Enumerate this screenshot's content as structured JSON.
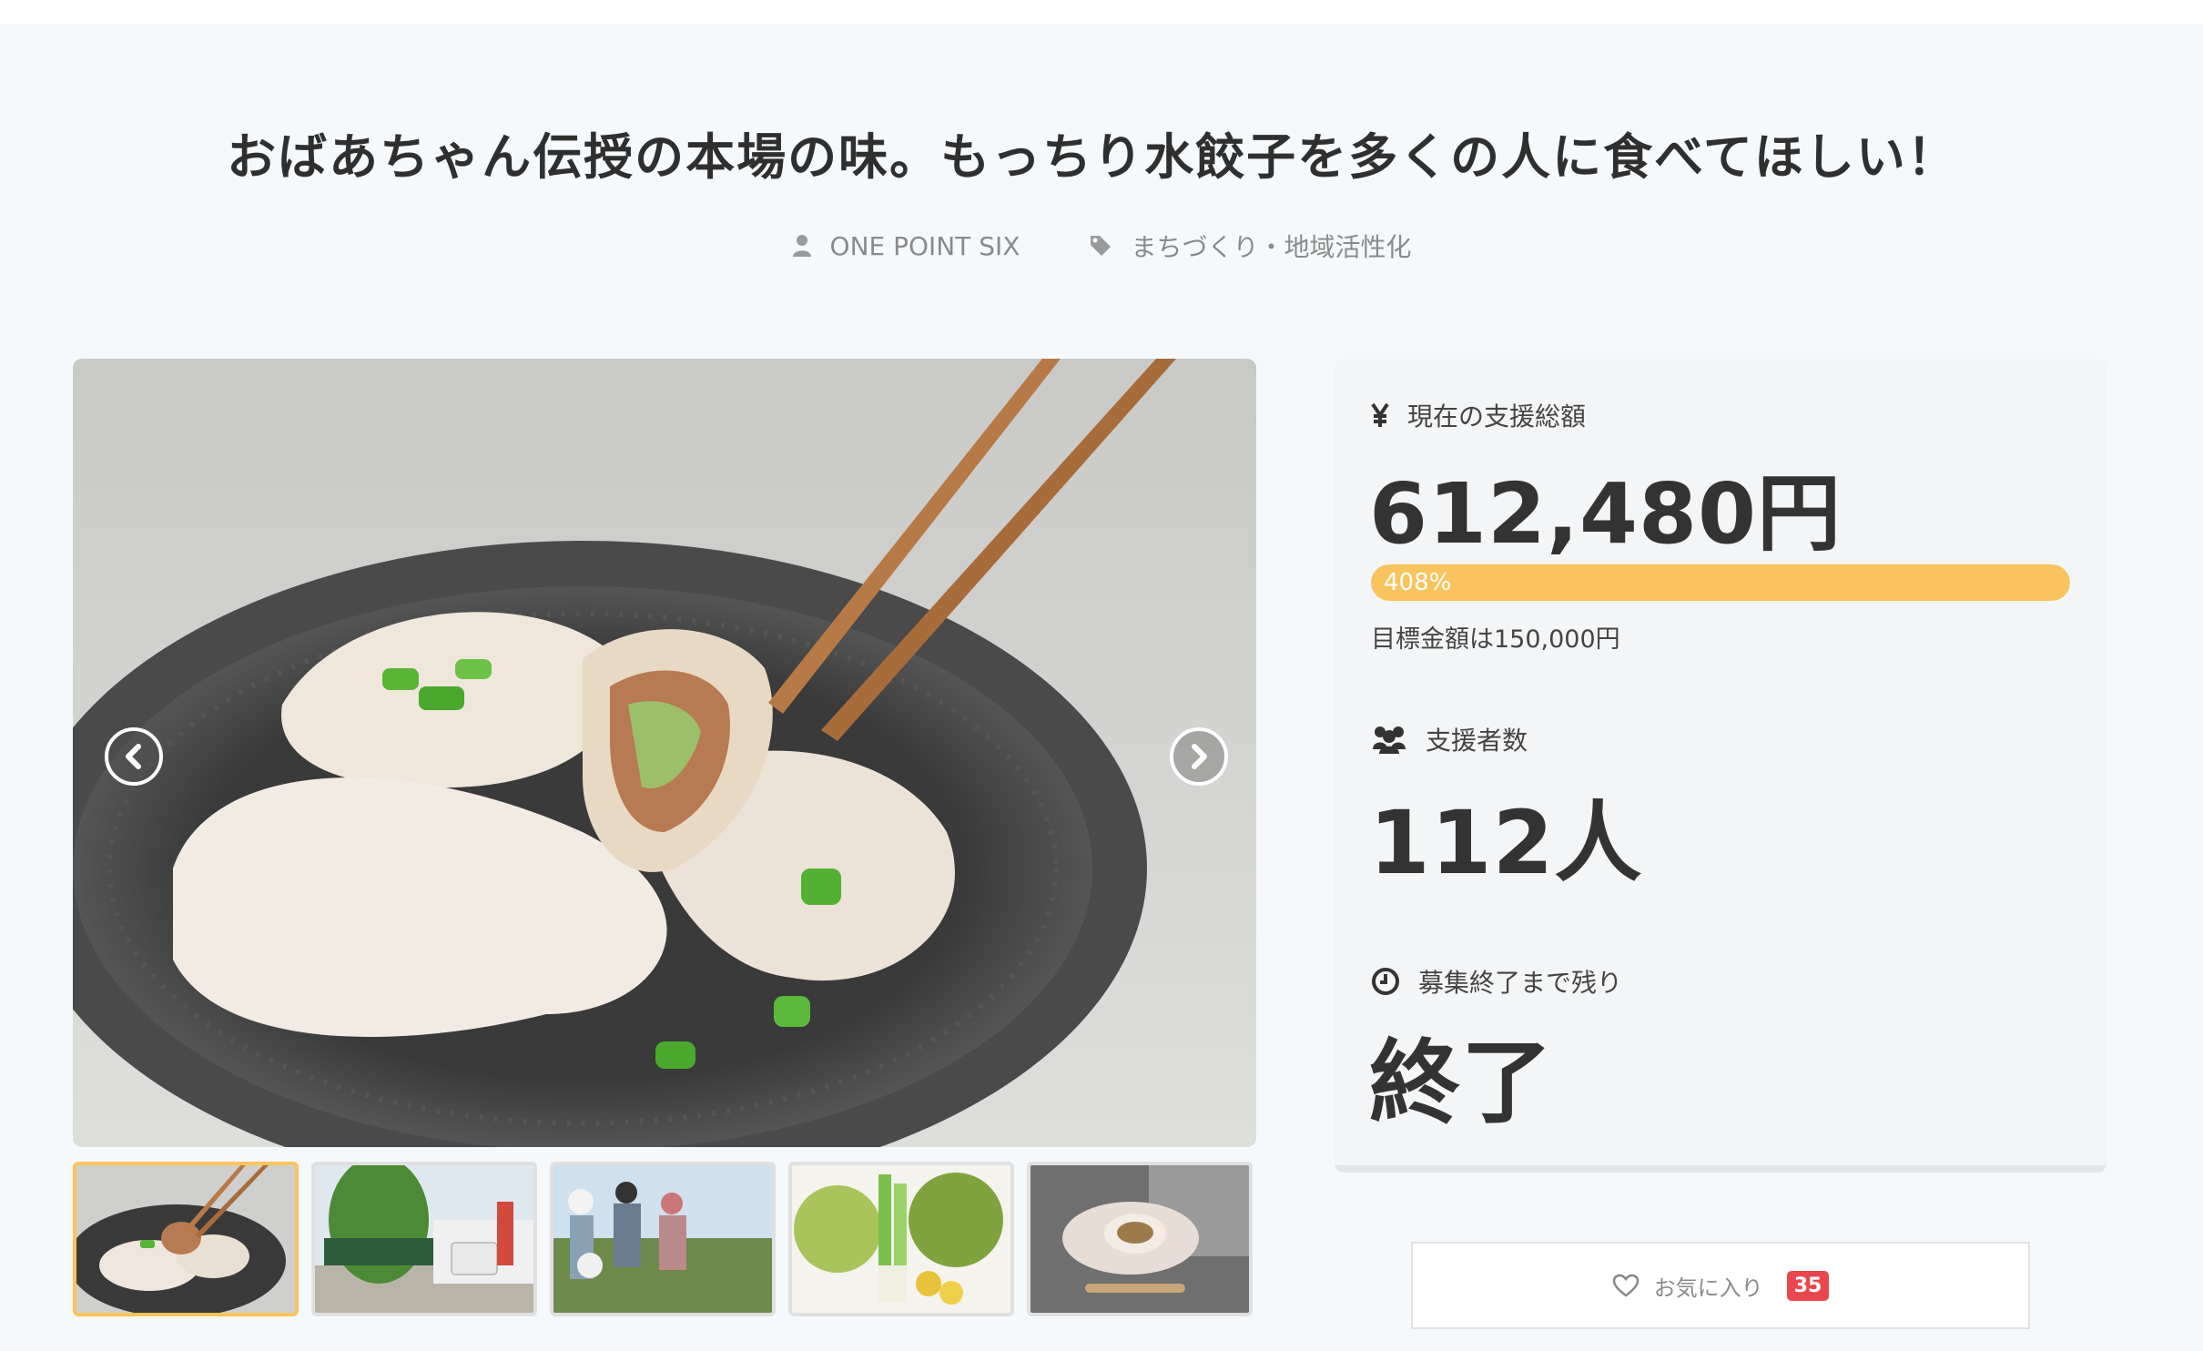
{
  "project": {
    "title": "おばあちゃん伝授の本場の味。もっちり水餃子を多くの人に食べてほしい！",
    "owner": "ONE POINT SIX",
    "category": "まちづくり・地域活性化"
  },
  "icons": {
    "owner": "user-icon",
    "category": "tag-icon",
    "total": "yen-icon",
    "backers": "users-icon",
    "remaining": "clock-icon",
    "favorite": "heart-icon",
    "prev": "chevron-left-icon",
    "next": "chevron-right-icon"
  },
  "stats": {
    "total_label": "現在の支援総額",
    "total_value": "612,480円",
    "progress_text": "408%",
    "progress_fraction": 1.0,
    "goal_text": "目標金額は150,000円",
    "backers_label": "支援者数",
    "backers_value": "112人",
    "remaining_label": "募集終了まで残り",
    "remaining_value": "終了"
  },
  "favorite": {
    "label": "お気に入り",
    "count": "35"
  },
  "colors": {
    "accent": "#f9c45d",
    "badge": "#e8484d",
    "background": "#f6f9fb",
    "text": "#333333"
  },
  "gallery": {
    "active_index": 0,
    "thumbnail_count": 5
  }
}
